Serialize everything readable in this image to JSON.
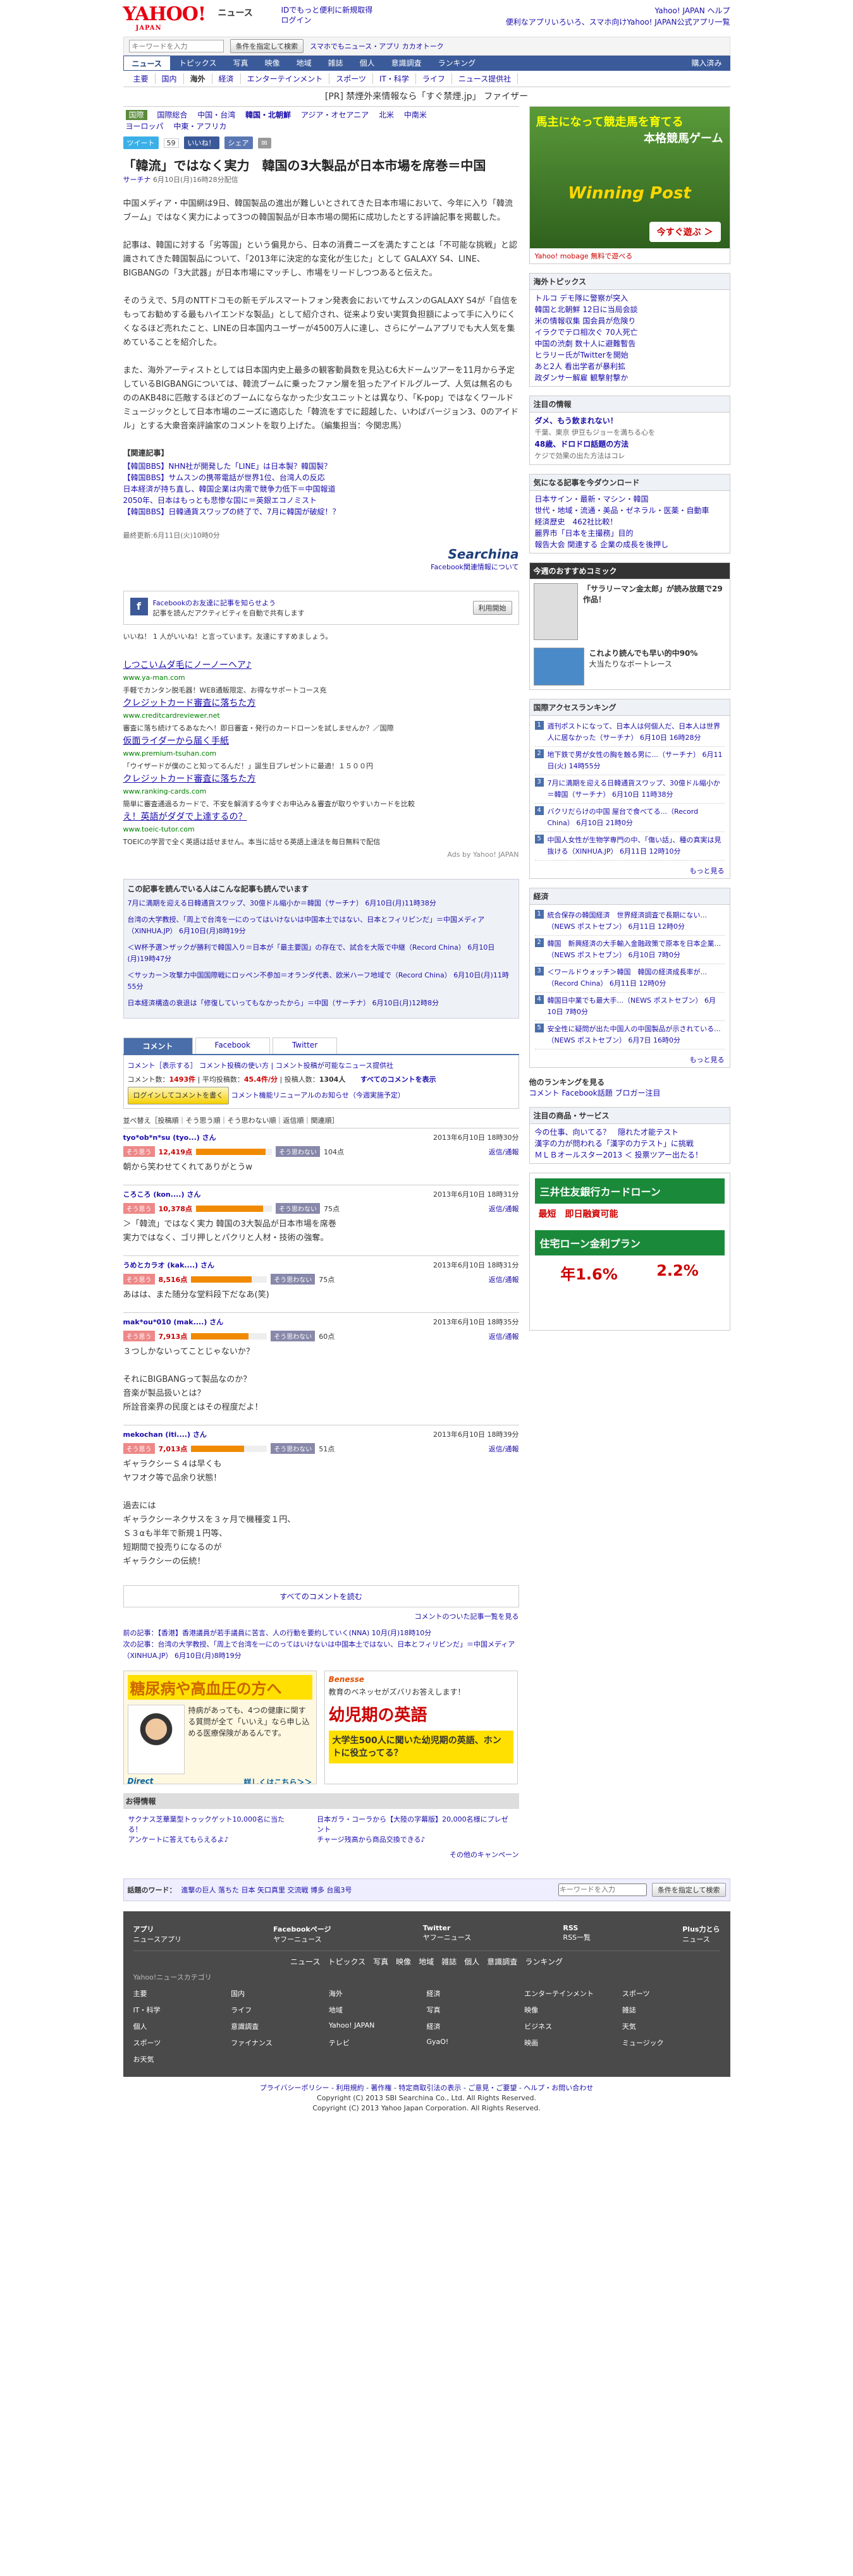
{
  "header": {
    "logo": "YAHOO!",
    "logo_sub": "JAPAN",
    "service": "ニュース",
    "login1": "IDでもっと便利に新規取得",
    "login2": "ログイン",
    "right1": "Yahoo! JAPAN ヘルプ",
    "right2": "便利なアプリいろいろ、スマホ向けYahoo! JAPAN公式アプリ一覧"
  },
  "search": {
    "placeholder": "キーワードを入力",
    "btn": "条件を指定して検索",
    "links": "スマホでもニュース・アプリ カカオトーク"
  },
  "nav1": {
    "items": [
      "ニュース",
      "トピックス",
      "写真",
      "映像",
      "地域",
      "雑誌",
      "個人",
      "意識調査",
      "ランキング"
    ],
    "right": "購入済み"
  },
  "nav2": {
    "items": [
      "主要",
      "国内",
      "海外",
      "経済",
      "エンターテインメント",
      "スポーツ",
      "IT・科学",
      "ライフ",
      "ニュース提供社"
    ]
  },
  "pr": {
    "text": "[PR] 禁煙外来情報なら「すぐ禁煙.jp」 ファイザー"
  },
  "cats": {
    "items": [
      "国際",
      "国際総合",
      "中国・台湾",
      "韓国・北朝鮮",
      "アジア・オセアニア",
      "北米",
      "中南米",
      "ヨーロッパ",
      "中東・アフリカ"
    ]
  },
  "social": {
    "tweet": "ツイート",
    "tweet_count": "59",
    "like": "いいね！",
    "share": "シェア",
    "mail": "✉"
  },
  "article": {
    "title": "「韓流」ではなく実力　韓国の3大製品が日本市場を席巻＝中国",
    "source": "サーチナ",
    "date": "6月10日(月)16時28分配信",
    "p1": "中国メディア・中国網は9日、韓国製品の進出が難しいとされてきた日本市場において、今年に入り「韓流ブーム」ではなく実力によって3つの韓国製品が日本市場の開拓に成功したとする評論記事を掲載した。",
    "p2": "記事は、韓国に対する「劣等国」という偏見から、日本の消費ニーズを満たすことは「不可能な挑戦」と認識されてきた韓国製品について、「2013年に決定的な変化が生じた」として GALAXY S4、LINE、BIGBANGの「3大武器」が日本市場にマッチし、市場をリードしつつあると伝えた。",
    "p3": "そのうえで、5月のNTTドコモの新モデルスマートフォン発表会においてサムスンのGALAXY S4が「自信をもってお勧めする最もハイエンドな製品」として紹介され、従来より安い実質負担額によって手に入りにくくなるほど売れたこと、LINEの日本国内ユーザーが4500万人に達し、さらにゲームアプリでも大人気を集めていることを紹介した。",
    "p4": "また、海外アーティストとしては日本国内史上最多の観客動員数を見込む6大ドームツアーを11月から予定しているBIGBANGについては、韓流ブームに乗ったファン層を狙ったアイドルグループ、人気は無名のもののAKB48に匹敵するほどのブームにならなかった少女ユニットとは異なり、「K-pop」ではなくワールドミュージックとして日本市場のニーズに適応した「韓流をすでに超越した、いわばバージョン3、0のアイドル」とする大衆音楽評論家のコメントを取り上げた。（編集担当：今関忠馬）",
    "related_title": "【関連記事】",
    "related": [
      "【韓国BBS】NHN社が開発した「LINE」は日本製？韓国製？",
      "【韓国BBS】サムスンの携帯電話が世界1位、台湾人の反応",
      "日本経済が持ち直し、韓国企業は内需で競争力低下＝中国報道",
      "2050年、日本はもっとも悲惨な国に＝英銀エコノミスト",
      "【韓国BBS】日韓通貨スワップの終了で、7月に韓国が破綻！？"
    ],
    "updated": "最終更新:6月11日(火)10時0分",
    "logo": "Searchina",
    "fb_link": "Facebook関連情報について"
  },
  "fb": {
    "title": "Facebookのお友達に記事を知らせよう",
    "desc": "記事を読んだアクティビティを自動で共有します",
    "btn": "利用開始",
    "likes": "いいね！ 1 人がいいね！と言っています。友達にすすめましょう。"
  },
  "ads": [
    {
      "t": "しつこいムダ毛にノーノーヘア♪",
      "u": "www.ya-man.com",
      "d": "手軽でカンタン脱毛器！WEB通販限定、お得なサポートコース充"
    },
    {
      "t": "クレジットカード審査に落ちた方",
      "u": "www.creditcardreviewer.net",
      "d": "審査に落ち続けてるあなたへ！即日審査・発行のカードローンを試しませんか？／国際"
    },
    {
      "t": "仮面ライダーから届く手紙",
      "u": "www.premium-tsuhan.com",
      "d": "「ウイザードが僕のこと知ってるんだ！」誕生日プレゼントに最適！１５００円"
    },
    {
      "t": "クレジットカード審査に落ちた方",
      "u": "www.ranking-cards.com",
      "d": "簡単に審査通過るカードで、不安を解消する今すぐお申込み＆審査が取りやすいカードを比較"
    },
    {
      "t": "え！英語がダダで上達するの？",
      "u": "www.toeic-tutor.com",
      "d": "TOEICの学習で全く英語は話せません。本当に話せる英語上達法を毎日無料で配信"
    }
  ],
  "ads_by": "Ads by Yahoo! JAPAN",
  "readers": {
    "title": "この記事を読んでいる人はこんな記事も読んでいます",
    "items": [
      "7月に満期を迎える日韓通貨スワップ、30億ドル縮小か＝韓国（サーチナ） 6月10日(月)11時38分",
      "台湾の大学教授、「周上で台湾を一にのってはいけないは中国本土ではない、日本とフィリピンだ」＝中国メディア（XINHUA.JP） 6月10日(月)8時19分",
      "＜W杯予選＞ザックが勝利で韓国入り＝日本が「最主要国」の存在で、試合を大阪で中継（Record China） 6月10日(月)19時47分",
      "＜サッカー＞攻撃力中国国際戦にロッペン不参加＝オランダ代表、欧米ハーフ地域で（Record China） 6月10日(月)11時55分",
      "日本経済構造の衰退は「修復していってもなかったから」＝中国（サーチナ） 6月10日(月)12時8分"
    ]
  },
  "tabs": {
    "items": [
      "コメント",
      "Facebook",
      "Twitter"
    ]
  },
  "cmhead": {
    "l1": "コメント［表示する］",
    "l2": "コメント投稿の使い方 | コメント投稿が可能なニュース提供社",
    "count_label": "コメント数：",
    "count": "1493件",
    "avg_label": "平均投稿数：",
    "avg": "45.4件/分",
    "users_label": "投稿人数：",
    "users": "1304人",
    "all": "すべてのコメントを表示",
    "login": "ログインしてコメントを書く",
    "view": "コメント機能リニューアルのお知らせ（今週実施予定）"
  },
  "sort": "並べ替え［投稿順｜そう思う順｜そう思わない順｜返信順｜関連順］",
  "comments": [
    {
      "name": "tyo*ob*n*su (tyo...) さん",
      "date": "2013年6月10日 18時30分",
      "like": "12,419点",
      "nolike": "104点",
      "pct": 0.92,
      "body": "朝から笑わせてくれてありがとうw"
    },
    {
      "name": "ころころ (kon....) さん",
      "date": "2013年6月10日 18時31分",
      "like": "10,378点",
      "nolike": "75点",
      "pct": 0.88,
      "body": "＞「韓流」ではなく実力 韓国の3大製品が日本市場を席巻\n実力ではなく、ゴリ押しとパクリと人材・技術の強奪。"
    },
    {
      "name": "うめとカラオ (kak....) さん",
      "date": "2013年6月10日 18時31分",
      "like": "8,516点",
      "nolike": "75点",
      "pct": 0.8,
      "body": "あはは、また随分な堂料段下だなあ(笑)"
    },
    {
      "name": "mak*ou*010 (mak....) さん",
      "date": "2013年6月10日 18時35分",
      "like": "7,913点",
      "nolike": "60点",
      "pct": 0.76,
      "body": "３つしかないってことじゃないか？\n\nそれにBIGBANGって製品なのか？\n音楽が製品扱いとは？\n所詮音楽界の民度とはその程度だよ！"
    },
    {
      "name": "mekochan (iti....) さん",
      "date": "2013年6月10日 18時39分",
      "like": "7,013点",
      "nolike": "51点",
      "pct": 0.7,
      "body": "ギャラクシーＳ４は早くも\nヤフオク等で品余り状態！\n\n過去には\nギャラクシーネクサスを３ヶ月で機種変１円、\nＳ３αも半年で新規１円等、\n短期間で投売りになるのが\nギャラクシーの伝統！"
    }
  ],
  "cm_actions": {
    "reply": "返信/通報",
    "like_lbl": "そう思う",
    "nolike_lbl": "そう思わない"
  },
  "allc": "すべてのコメントを読む",
  "cm_more": "コメントのついた記事一覧を見る",
  "prevnext": {
    "prev": "前の記事：【香港】香港議員が若手議員に苦言、人の行動を要約していく(NNA) 10月(月)18時10分",
    "next": "次の記事：台湾の大学教授、「周上で台湾を一にのってはいけないは中国本土ではない、日本とフィリピンだ」＝中国メディア（XINHUA.JP） 6月10日(月)8時19分"
  },
  "adb1": {
    "title": "糖尿病や高血圧の方へ",
    "body": "持病があっても、4つの健康に関する質問が全て「いいえ」なら申し込める医療保険があるんです。",
    "brand": "Direct",
    "link": "詳しくはこちら＞＞"
  },
  "adb2": {
    "brand": "Benesse",
    "body": "教育のベネッセがズバリお答えします！",
    "title": "幼児期の英語",
    "sub": "大学生500人に聞いた幼児期の英語、ホントに役立ってる？"
  },
  "otoku": {
    "title": "お得情報",
    "i1": "サクナス芝華葉型トゥックゲット10,000名に当たる！",
    "i1b": "アンケートに答えてもらえるよ♪",
    "i2": "日本ガラ・コーラから【大陸の字幕版】20,000名様にプレゼント",
    "i2b": "チャージ残高から商品交換できる♪",
    "more": "その他のキャンペーン"
  },
  "topic": {
    "label": "話題のワード：",
    "words": "進撃の巨人  落ちた  日本  矢口真里  交流戦  博多  台風3号",
    "placeholder": "キーワードを入力",
    "btn": "条件を指定して検索"
  },
  "footer": {
    "apps": [
      {
        "t": "アプリ",
        "d": "ニュースアプリ"
      },
      {
        "t": "Facebookページ",
        "d": "ヤフーニュース"
      },
      {
        "t": "Twitter",
        "d": "ヤフーニュース"
      },
      {
        "t": "RSS",
        "d": "RSS一覧"
      },
      {
        "t": "Plus力とら",
        "d": "ニュース"
      }
    ],
    "nav": [
      "ニュース",
      "トピックス",
      "写真",
      "映像",
      "地域",
      "雑誌",
      "個人",
      "意識調査",
      "ランキング"
    ],
    "cat_title": "Yahoo!ニュースカテゴリ",
    "cats": [
      "主要",
      "国内",
      "海外",
      "経済",
      "エンターテインメント",
      "スポーツ",
      "IT・科学",
      "ライフ",
      "地域",
      "写真",
      "映像",
      "雑誌",
      "個人",
      "意識調査",
      "Yahoo! JAPAN",
      "経済",
      "ビジネス",
      "天気",
      "スポーツ",
      "ファイナンス",
      "テレビ",
      "GyaO!",
      "映画",
      "ミュージック",
      "お天気"
    ],
    "bottom1": "プライバシーポリシー - 利用規約 - 著作権 - 特定商取引法の表示 - ご意見・ご要望 - ヘルプ・お問い合わせ",
    "bottom2": "Copyright (C) 2013 SBI Searchina Co., Ltd. All Rights Reserved.",
    "bottom3": "Copyright (C) 2013 Yahoo Japan Corporation. All Rights Reserved."
  },
  "side": {
    "ad1": {
      "title": "馬主になって競走馬を育てる",
      "sub": "本格競馬ゲーム",
      "brand": "Winning Post",
      "btn": "今すぐ遊ぶ ＞",
      "footer": "Yahoo! mobage 無料で遊べる"
    },
    "topics_title": "海外トピックス",
    "topics": [
      "トルコ デモ隊に警察が突入",
      "韓国と北朝鮮 12日に当局会談",
      "米の情報収集 国会員が危険り",
      "イラクでテロ相次ぐ 70人死亡",
      "中国の渋劇 数十人に避難暫告",
      "ヒラリー氏がTwitterを開始",
      "あと2人 看出学者が暴利拡",
      "政ダンサー解雇 観撃射撃か"
    ],
    "notice_title": "注目の情報",
    "n1": "ダメ、もう飲まれない！",
    "n1b": "千葉、東京 伊豆もジョーを満ちる心を",
    "n2": "48歳、ドロドロ話題の方法",
    "n2b": "ケジで効果の出た方法はコレ",
    "ent_title": "気になる記事を今ダウンロード",
    "ent": [
      "日本サイン・最新・マシン・韓国",
      "世代・地域・流通・美品・ゼネラル・医薬・自動車",
      "経済歴史　462社比較！",
      "麗界市「日本を主撮務」目的",
      "報告大会 関連する 企業の成長を後押し"
    ],
    "comic_title": "今週のおすすめコミック",
    "c1": "「サラリーマン金太郎」が読み放題で29作品！",
    "c2": "これより読んでも早い的中90%",
    "c2b": "大当たりなボートレース",
    "rank_title": "国際アクセスランキング",
    "rank": [
      "週刊ポストになって、日本人は何個人だ、日本人は世界人に居なかった（サーチナ） 6月10日 16時28分",
      "地下鉄で男が女性の胸を触る男に...（サーチナ） 6月11日(火) 14時55分",
      "7月に満期を迎える日韓通貨スワップ、30億ドル縮小か＝韓国（サーチナ） 6月10日 11時38分",
      "バクリだらけの中国 屋台で食べてる...（Record China） 6月10日 21時0分",
      "中国人女性が生物学専門の中、「傷い話」、種の真実は見抜ける（XINHUA.JP） 6月11日 12時10分"
    ],
    "rank_more": "もっと見る",
    "keizai_title": "経済",
    "keizai": [
      "統合保存の韓国経済　世界経済調査で長期にない...（NEWS ポストセブン） 6月11日 12時0分",
      "韓国　新興経済の大手輸入金融政策で原本を日本企業...（NEWS ポストセブン） 6月10日 7時0分",
      "＜ワールドウォッチ＞韓国　韓国の経済成長率が...（Record China） 6月11日 12時0分",
      "韓国日中業でも最大手...（NEWS ポストセブン） 6月10日 7時0分",
      "安全性に疑問が出た中国人の中国製品が示されている...（NEWS ポストセブン） 6月7日 16時0分"
    ],
    "keizai_more": "もっと見る",
    "social_title": "他のランキングを見る",
    "social_links": "コメント Facebook話題 ブロガー注目",
    "service_title": "注目の商品・サービス",
    "service": [
      "今の仕事、向いてる？　隠れた才能テスト",
      "漢字の力が問われる「漢字の力テスト」に挑戦",
      "ＭＬＢオールスター2013 ＜ 投票ツアー出たる！"
    ],
    "ad2": {
      "t1": "三井住友銀行カードローン",
      "t2": "最短　即日融資可能",
      "t3": "住宅ローン金利プラン",
      "r1": "年1.6%",
      "r2": "2.2%"
    }
  }
}
